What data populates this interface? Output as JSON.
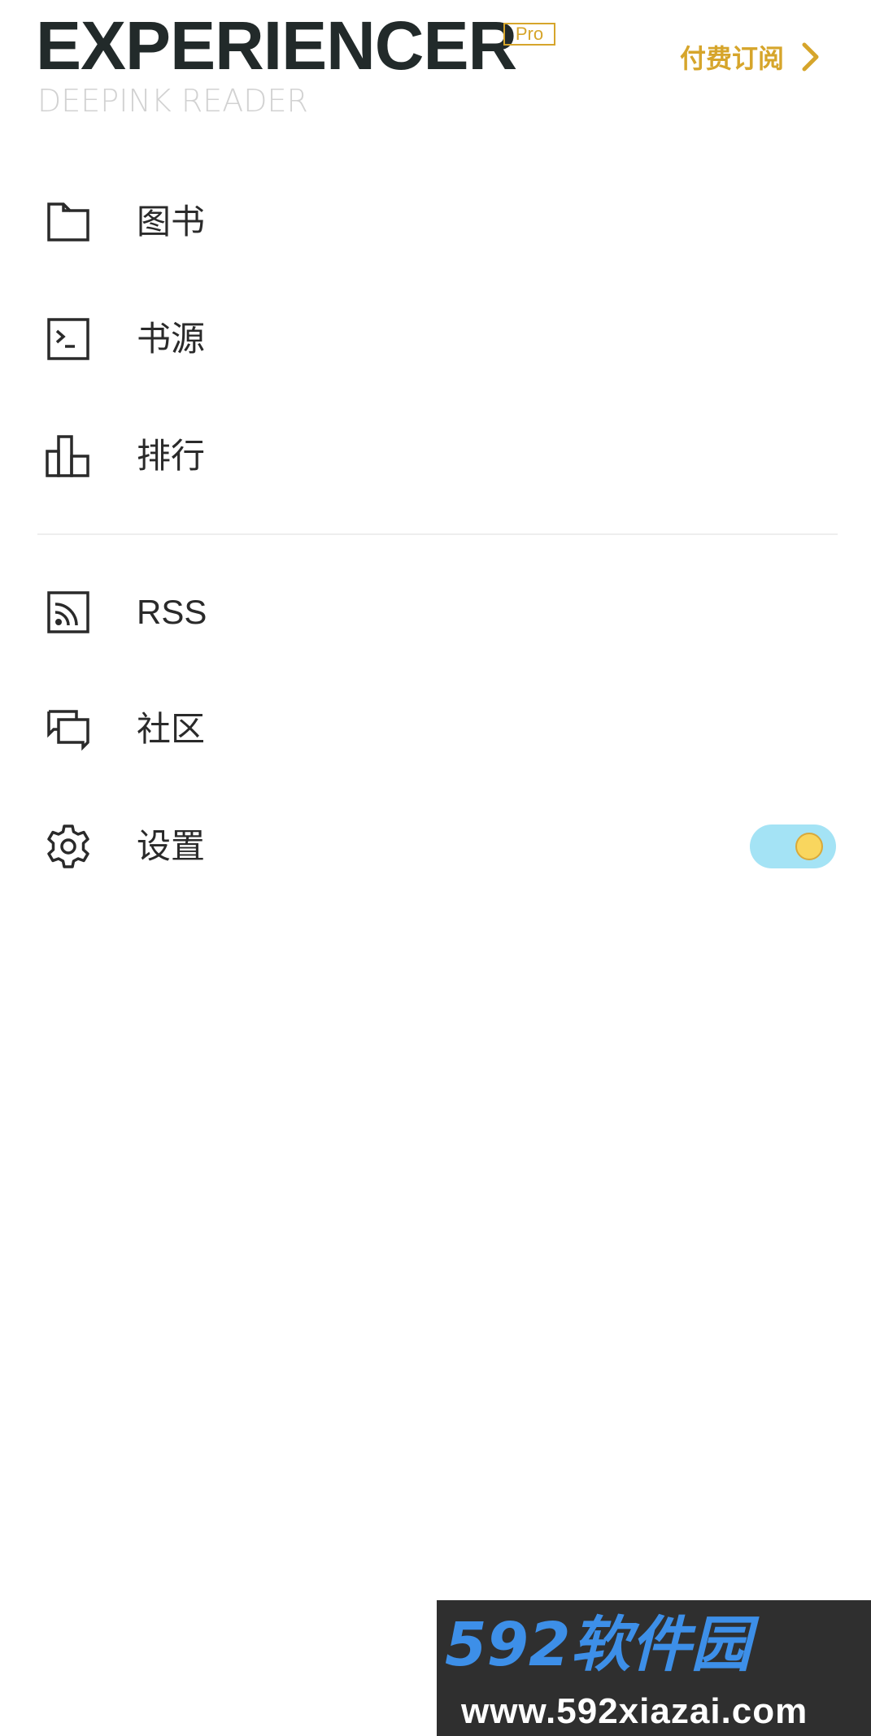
{
  "header": {
    "app_title": "EXPERIENCER",
    "badge": "Pro",
    "subtitle": "DEEPINK READER",
    "subscribe_label": "付费订阅"
  },
  "menu": {
    "items": [
      {
        "label": "图书",
        "icon": "folder-icon"
      },
      {
        "label": "书源",
        "icon": "terminal-icon"
      },
      {
        "label": "排行",
        "icon": "bar-chart-icon"
      },
      {
        "label": "RSS",
        "icon": "rss-icon"
      },
      {
        "label": "社区",
        "icon": "chat-bubbles-icon"
      },
      {
        "label": "设置",
        "icon": "gear-icon"
      }
    ]
  },
  "settings_toggle": {
    "state": "on"
  },
  "watermark": {
    "logo_text": "592软件园",
    "url": "www.592xiazai.com"
  },
  "colors": {
    "accent": "#d6a52b",
    "title": "#222a2a",
    "subtitle": "#d2d2d2",
    "toggle_track": "#a4e3f5",
    "toggle_knob": "#f9d65e"
  }
}
